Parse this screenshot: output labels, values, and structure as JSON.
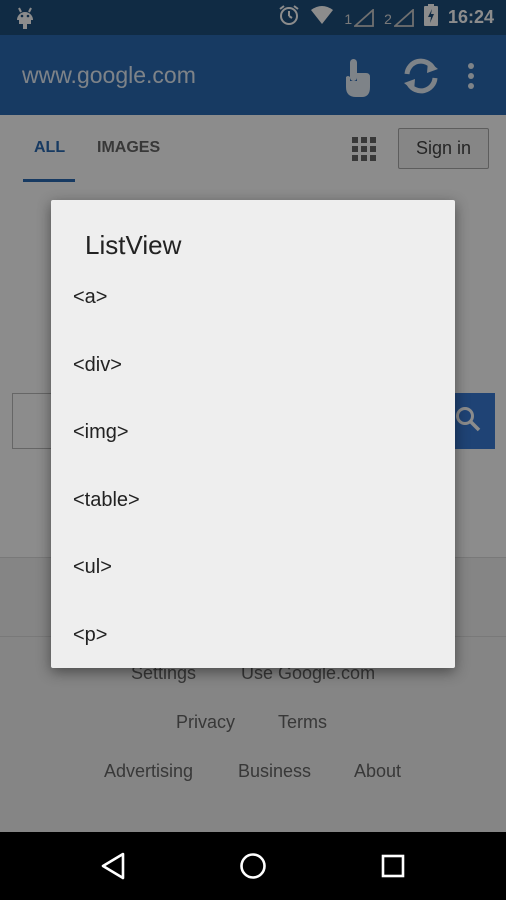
{
  "status_bar": {
    "time": "16:24",
    "sim1_label": "1",
    "sim2_label": "2",
    "icons": [
      "android-icon",
      "alarm-icon",
      "wifi-icon",
      "signal-icon",
      "battery-icon"
    ]
  },
  "app_bar": {
    "url": "www.google.com",
    "icons": [
      "touch-icon",
      "refresh-icon",
      "overflow-menu-icon"
    ]
  },
  "page": {
    "tabs": [
      {
        "label": "ALL"
      },
      {
        "label": "IMAGES"
      }
    ],
    "sign_in": "Sign in",
    "footer": {
      "settings": "Settings",
      "use_google": "Use Google.com",
      "privacy": "Privacy",
      "terms": "Terms",
      "advertising": "Advertising",
      "business": "Business",
      "about": "About"
    }
  },
  "dialog": {
    "title": "ListView",
    "items": [
      "<a>",
      "<div>",
      "<img>",
      "<table>",
      "<ul>",
      "<p>"
    ]
  },
  "colors": {
    "status_bar": "#1e4f7d",
    "app_bar": "#2a6ab2",
    "accent": "#2a6ab2",
    "dialog_bg": "#eeeeee"
  }
}
